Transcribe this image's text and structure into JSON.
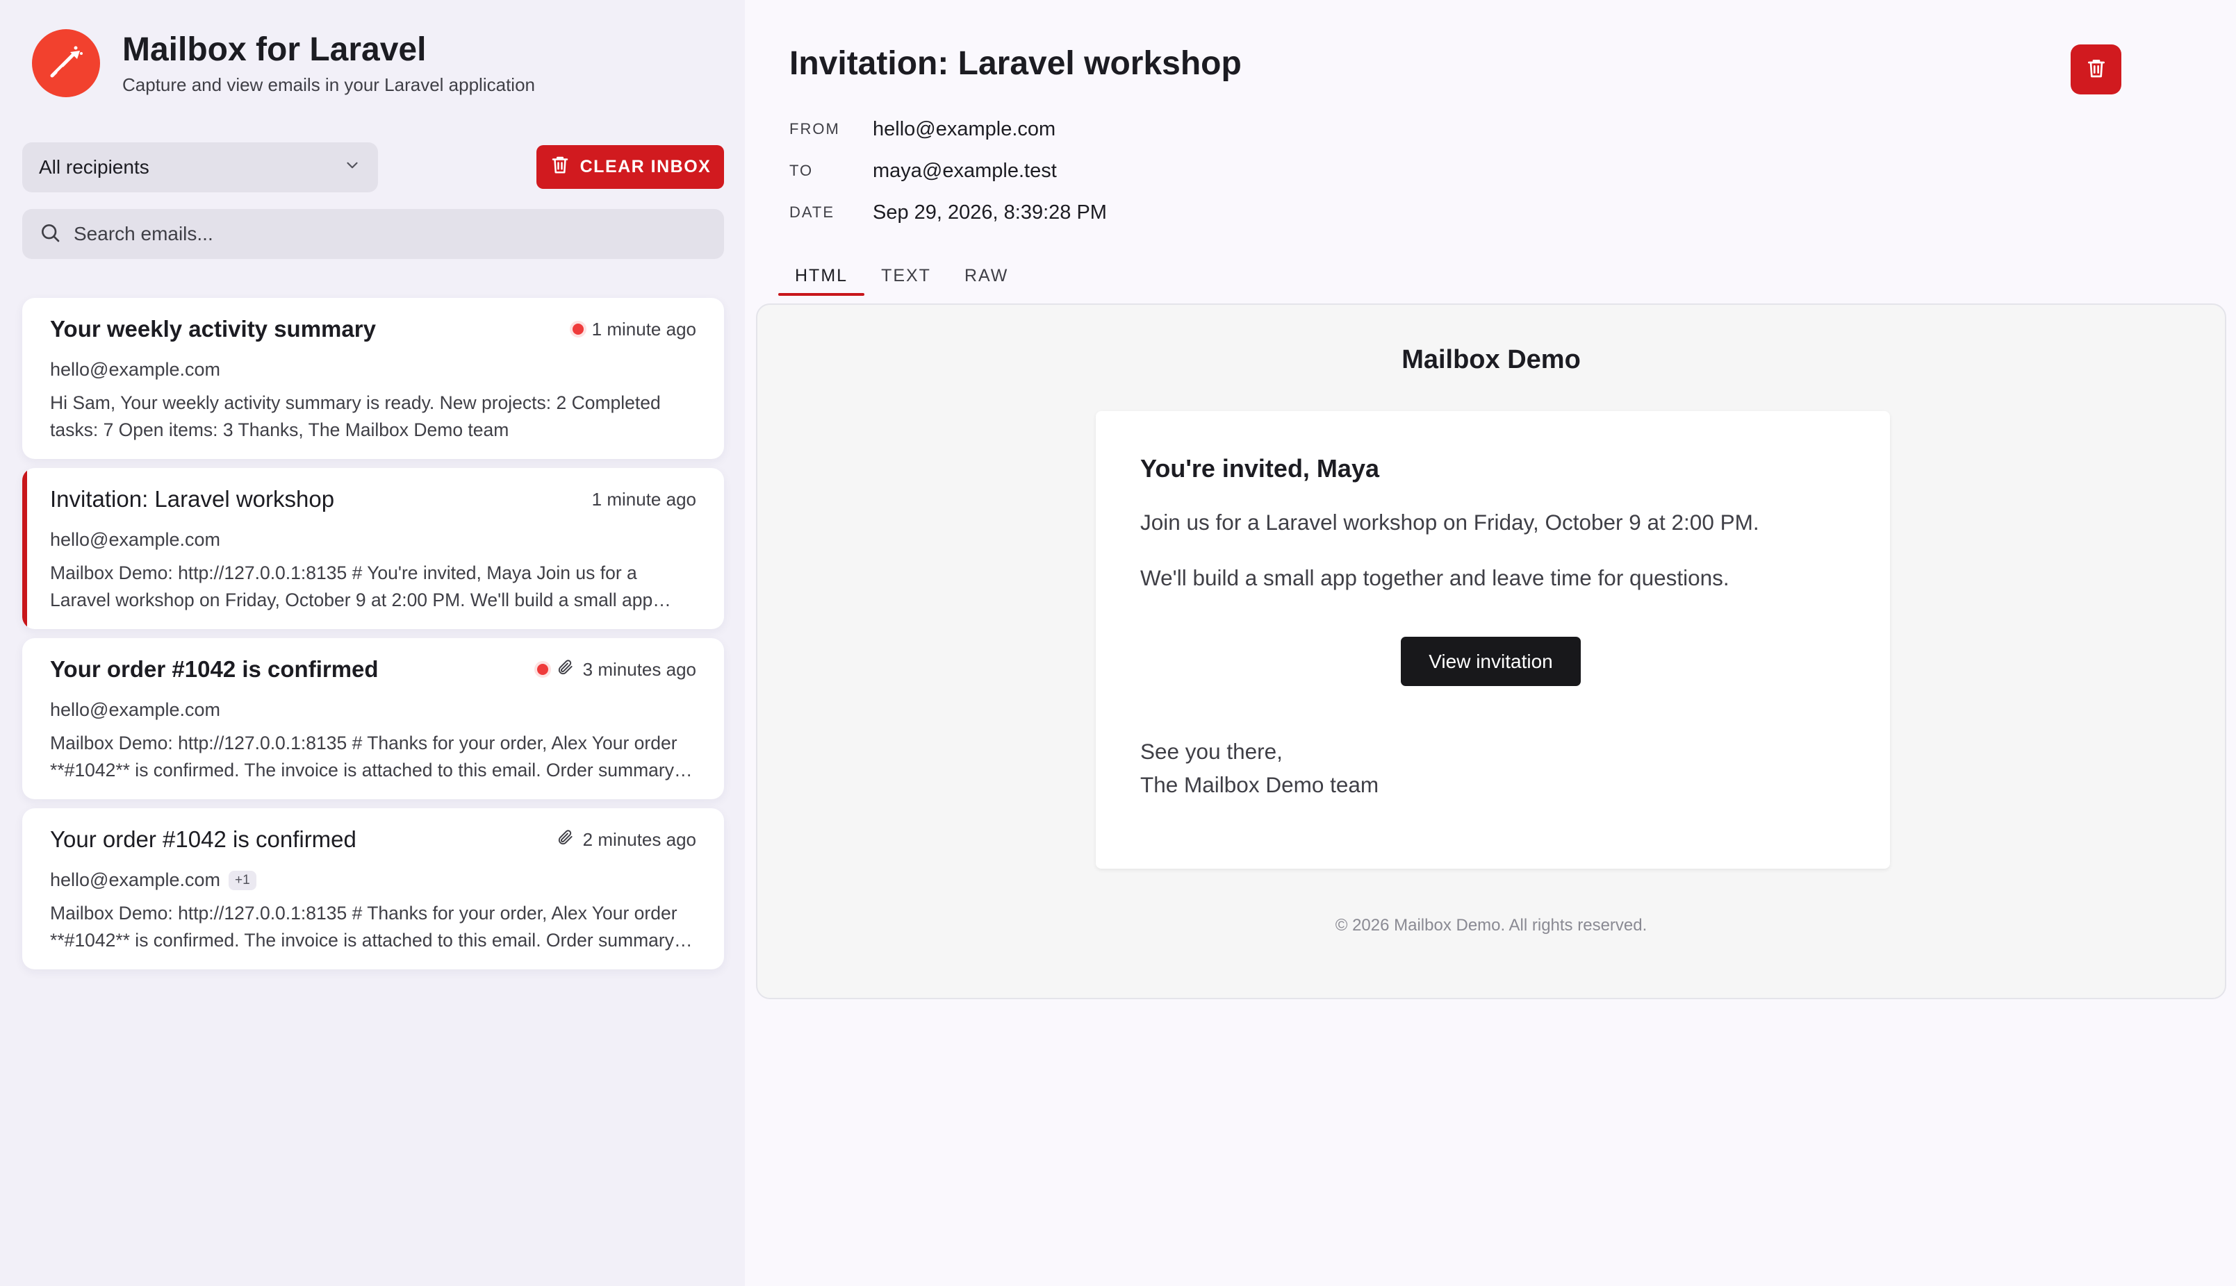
{
  "app": {
    "title": "Mailbox for Laravel",
    "subtitle": "Capture and view emails in your Laravel application"
  },
  "filters": {
    "recipient_selected": "All recipients",
    "clear_label": "CLEAR INBOX",
    "search_placeholder": "Search emails..."
  },
  "emails": [
    {
      "subject": "Your weekly activity summary",
      "time": "1 minute ago",
      "from": "hello@example.com",
      "preview": "Hi Sam, Your weekly activity summary is ready. New projects: 2 Completed tasks: 7 Open items: 3 Thanks, The Mailbox Demo team",
      "unread": true,
      "attachment": false
    },
    {
      "subject": "Invitation: Laravel workshop",
      "time": "1 minute ago",
      "from": "hello@example.com",
      "preview": "Mailbox Demo: http://127.0.0.1:8135 # You're invited, Maya Join us for a Laravel workshop on Friday, October 9 at 2:00 PM. We'll build a small app together and leave time for questions.",
      "unread": false,
      "attachment": false,
      "selected": true
    },
    {
      "subject": "Your order #1042 is confirmed",
      "time": "3 minutes ago",
      "from": "hello@example.com",
      "preview": "Mailbox Demo: http://127.0.0.1:8135 # Thanks for your order, Alex Your order **#1042** is confirmed. The invoice is attached to this email. Order summary attached.",
      "unread": true,
      "attachment": true
    },
    {
      "subject": "Your order #1042 is confirmed",
      "time": "2 minutes ago",
      "from": "hello@example.com",
      "extra_recipients": "+1",
      "preview": "Mailbox Demo: http://127.0.0.1:8135 # Thanks for your order, Alex Your order **#1042** is confirmed. The invoice is attached to this email. Order summary attached.",
      "unread": false,
      "attachment": true
    }
  ],
  "detail": {
    "subject": "Invitation: Laravel workshop",
    "from_label": "FROM",
    "from": "hello@example.com",
    "to_label": "TO",
    "to": "maya@example.test",
    "date_label": "DATE",
    "date": "Sep 29, 2026, 8:39:28 PM",
    "tabs": [
      "HTML",
      "TEXT",
      "RAW"
    ],
    "active_tab": "HTML"
  },
  "preview": {
    "brand": "Mailbox Demo",
    "greeting": "You're invited, Maya",
    "paragraph_1": "Join us for a Laravel workshop on Friday, October 9 at 2:00 PM.",
    "paragraph_2": "We'll build a small app together and leave time for questions.",
    "button_label": "View invitation",
    "signoff_line_1": "See you there,",
    "signoff_line_2": "The Mailbox Demo team",
    "footer": "© 2026 Mailbox Demo. All rights reserved."
  },
  "colors": {
    "accent": "#d11a1f",
    "logo": "#f2412e",
    "unread_dot": "#ef3b3b"
  }
}
